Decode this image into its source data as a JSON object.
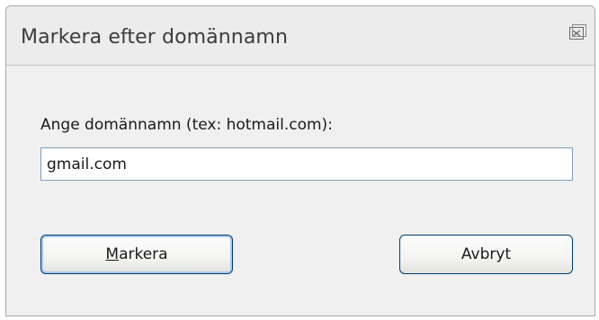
{
  "window": {
    "title": "Markera efter domännamn",
    "close_icon": "close-icon"
  },
  "form": {
    "prompt": "Ange domännamn (tex: hotmail.com):",
    "domain_value": "gmail.com"
  },
  "buttons": {
    "primary_accel": "M",
    "primary_rest": "arkera",
    "cancel": "Avbryt"
  },
  "colors": {
    "dialog_bg": "#f0f0f0",
    "button_border": "#003c74",
    "focus_ring": "#a9c9f5",
    "input_border": "#7f9db9"
  }
}
